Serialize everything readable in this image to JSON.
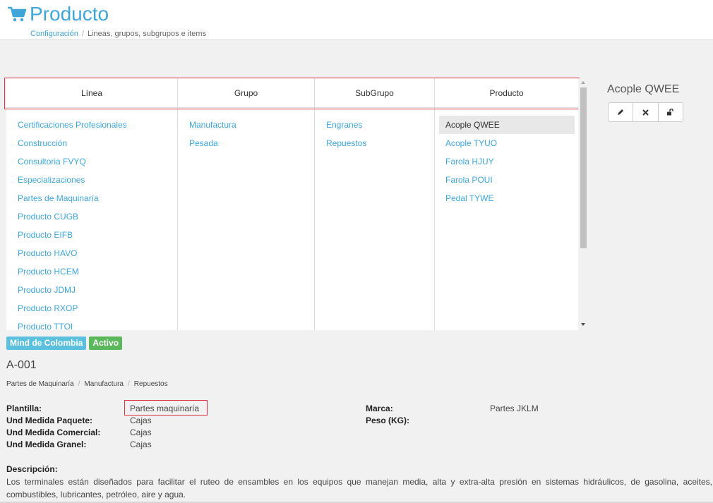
{
  "header": {
    "title": "Producto",
    "breadcrumb": {
      "link": "Configuración",
      "separator": "/",
      "current": "Lineas, grupos, subgrupos e items"
    }
  },
  "browser": {
    "columns": [
      "Línea",
      "Grupo",
      "SubGrupo",
      "Producto"
    ],
    "lineas": [
      "Certificaciones Profesionales",
      "Construcción",
      "Consultoria FVYQ",
      "Especializaciones",
      "Partes de Maquinaría",
      "Producto CUGB",
      "Producto EIFB",
      "Producto HAVO",
      "Producto HCEM",
      "Producto JDMJ",
      "Producto RXOP",
      "Producto TTOI"
    ],
    "grupos": [
      "Manufactura",
      "Pesada"
    ],
    "subgrupos": [
      "Engranes",
      "Repuestos"
    ],
    "productos": [
      "Acople QWEE",
      "Acople TYUO",
      "Farola HJUY",
      "Farola POUI",
      "Pedal TYWE"
    ],
    "selected_product": "Acople QWEE"
  },
  "detail": {
    "title": "Acople QWEE",
    "buttons": {
      "edit": "pencil-icon",
      "delete": "times-icon",
      "unlock": "unlock-icon"
    },
    "badges": {
      "company": "Mind de Colombia",
      "status": "Activo"
    },
    "code": "A-001",
    "path": [
      "Partes de Maquinaría",
      "Manufactura",
      "Repuestos"
    ],
    "path_separator": "/",
    "plantilla_label": "Plantilla:",
    "plantilla_value": "Partes maquinaría",
    "und_paquete_label": "Und Medida Paquete:",
    "und_paquete_value": "Cajas",
    "und_comercial_label": "Und Medida Comercial:",
    "und_comercial_value": "Cajas",
    "und_granel_label": "Und Medida Granel:",
    "und_granel_value": "Cajas",
    "marca_label": "Marca:",
    "marca_value": "Partes JKLM",
    "peso_label": "Peso (KG):",
    "peso_value": "",
    "descripcion_label": "Descripción:",
    "descripcion": "Los terminales están diseñados para facilitar el ruteo de ensambles en los equipos que manejan media, alta y extra-alta presión en sistemas hidráulicos, de gasolina, aceites, combustibles, lubricantes, petróleo, aire y agua."
  },
  "colors": {
    "accent": "#3fa6d9",
    "highlight_border": "#d9343f",
    "badge_blue": "#5bc0de",
    "badge_green": "#5cb85c"
  }
}
